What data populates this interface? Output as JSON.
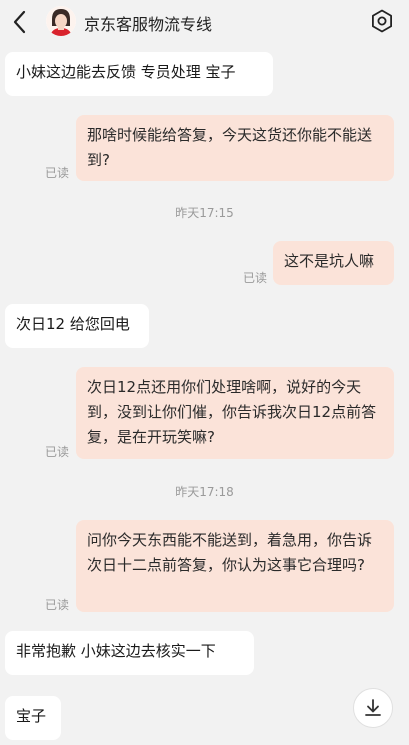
{
  "header": {
    "title": "京东客服物流专线"
  },
  "messages": [
    {
      "text": "小妹这边能去反馈 专员处理   宝子"
    },
    {
      "text": "那啥时候能给答复，今天这货还你能不能送到?",
      "read": "已读"
    },
    {
      "text": "这不是坑人嘛",
      "read": "已读"
    },
    {
      "text": "次日12 给您回电"
    },
    {
      "text": "次日12点还用你们处理啥啊，说好的今天到，没到让你们催，你告诉我次日12点前答复，是在开玩笑嘛?",
      "read": "已读"
    },
    {
      "text": "问你今天东西能不能送到，着急用，你告诉次日十二点前答复，你认为这事它合理吗?",
      "read": "已读"
    },
    {
      "text": "非常抱歉   小妹这边去核实一下"
    },
    {
      "text": "宝子"
    }
  ],
  "timestamps": [
    "昨天17:15",
    "昨天17:18"
  ],
  "icons": {
    "back": "chevron-left-icon",
    "settings": "gear-icon",
    "scroll": "arrow-down-icon"
  }
}
